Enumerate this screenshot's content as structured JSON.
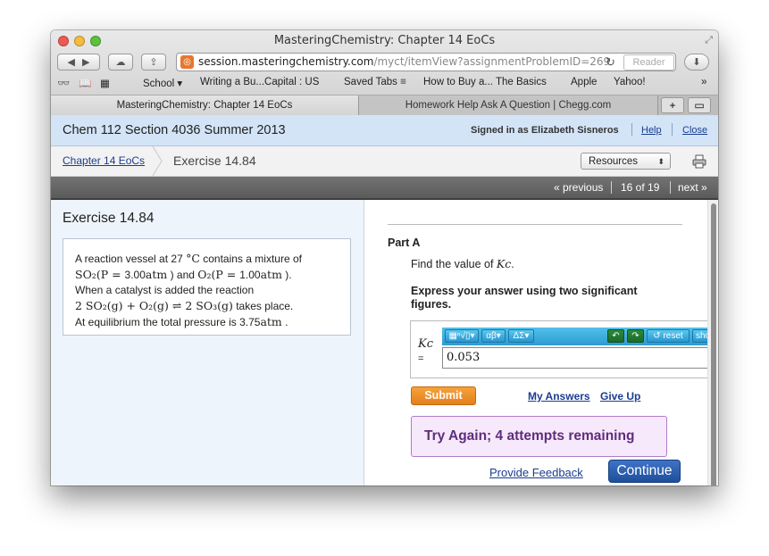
{
  "window": {
    "title": "MasteringChemistry: Chapter 14 EoCs"
  },
  "toolbar": {
    "url_host": "session.masteringchemistry.com",
    "url_rest": "/myct/itemView?assignmentProblemID=269",
    "reader_label": "Reader"
  },
  "bookmarks": [
    {
      "label": "School ▾"
    },
    {
      "label": "Writing a Bu...Capital : US"
    },
    {
      "label": "Saved Tabs ≡"
    },
    {
      "label": "How to Buy a... The Basics"
    },
    {
      "label": "Apple"
    },
    {
      "label": "Yahoo!"
    }
  ],
  "tabs": [
    {
      "label": "MasteringChemistry: Chapter 14 EoCs",
      "active": true
    },
    {
      "label": "Homework Help Ask A Question | Chegg.com",
      "active": false
    }
  ],
  "header": {
    "course_title": "Chem 112 Section 4036 Summer 2013",
    "signed_in": "Signed in as Elizabeth Sisneros",
    "help": "Help",
    "close": "Close"
  },
  "breadcrumb": {
    "parent": "Chapter 14 EoCs",
    "current": "Exercise 14.84",
    "resources": "Resources"
  },
  "nav": {
    "previous": "« previous",
    "position": "16 of 19",
    "next": "next »"
  },
  "problem": {
    "title": "Exercise 14.84",
    "line1_a": "A reaction vessel at 27 ",
    "line1_b": "°C",
    "line1_c": " contains a mixture of",
    "line2_a": "SO₂(P = ",
    "line2_b": "3.00",
    "line2_c": "atm",
    "line2_d": " ) and ",
    "line2_e": "O₂(P = ",
    "line2_f": "1.00",
    "line2_g": "atm",
    "line2_h": " ).",
    "line3": "When a catalyst is added the reaction",
    "line4_eq": "2 SO₂(g) + O₂(g) ⇌ 2 SO₃(g)",
    "line4_tail": " takes place.",
    "line5_a": "At equilibrium the total pressure is ",
    "line5_b": "3.75",
    "line5_c": "atm",
    "line5_d": " ."
  },
  "part": {
    "title": "Part A",
    "question_prefix": "Find the value of ",
    "question_symbol": "Kc",
    "question_suffix": ".",
    "instruction": "Express your answer using two significant figures.",
    "answer_label": "Kc",
    "equals": "=",
    "answer_value": "0.053",
    "toolbar_buttons": [
      "▦ⁿ√▯▾",
      "αβ▾",
      "ΔΣ▾"
    ],
    "reset": "reset",
    "show": "show",
    "submit": "Submit",
    "my_answers": "My Answers",
    "give_up": "Give Up",
    "feedback": "Try Again; 4 attempts remaining",
    "provide_feedback": "Provide Feedback",
    "continue": "Continue"
  },
  "colors": {
    "header_bg": "#d3e4f7",
    "link": "#1a3d8f",
    "submit": "#e8871f",
    "feedback": "#5f2d7b",
    "continue": "#2a5db0"
  }
}
